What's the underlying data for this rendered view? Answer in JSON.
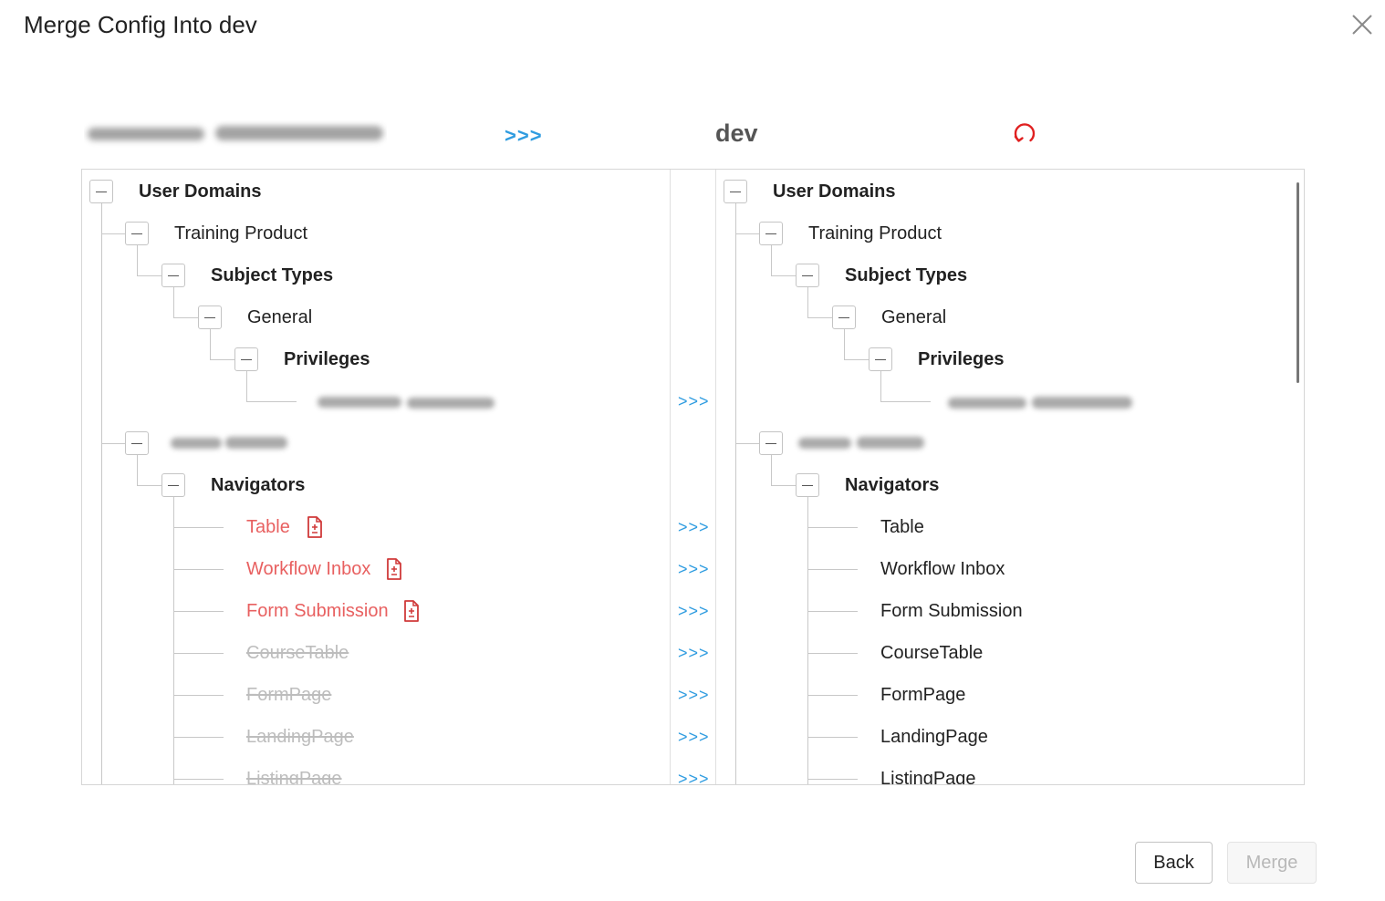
{
  "dialog": {
    "title": "Merge Config Into dev"
  },
  "header": {
    "arrow": ">>>",
    "target_name": "dev"
  },
  "left_tree": {
    "user_domains": "User Domains",
    "training_product": "Training Product",
    "subject_types": "Subject Types",
    "general": "General",
    "privileges": "Privileges",
    "navigators": "Navigators",
    "items": [
      {
        "label": "Table",
        "status": "changed"
      },
      {
        "label": "Workflow Inbox",
        "status": "changed"
      },
      {
        "label": "Form Submission",
        "status": "changed"
      },
      {
        "label": "CourseTable",
        "status": "deleted"
      },
      {
        "label": "FormPage",
        "status": "deleted"
      },
      {
        "label": "LandingPage",
        "status": "deleted"
      },
      {
        "label": "ListingPage",
        "status": "deleted"
      }
    ]
  },
  "right_tree": {
    "user_domains": "User Domains",
    "training_product": "Training Product",
    "subject_types": "Subject Types",
    "general": "General",
    "privileges": "Privileges",
    "navigators": "Navigators",
    "items": [
      {
        "label": "Table"
      },
      {
        "label": "Workflow Inbox"
      },
      {
        "label": "Form Submission"
      },
      {
        "label": "CourseTable"
      },
      {
        "label": "FormPage"
      },
      {
        "label": "LandingPage"
      },
      {
        "label": "ListingPage"
      }
    ]
  },
  "merge_arrows": [
    ">>>",
    ">>>",
    ">>>",
    ">>>",
    ">>>",
    ">>>",
    ">>>",
    ">>>"
  ],
  "buttons": {
    "back": "Back",
    "merge": "Merge"
  },
  "colors": {
    "arrow": "#2f9ce0",
    "changed": "#e86060",
    "diff_icon": "#d03a3a",
    "deleted": "#bdbdbd",
    "refresh": "#e02020"
  },
  "icons": {
    "close": "close-icon",
    "refresh": "refresh-icon",
    "diff": "document-diff-icon",
    "toggle": "collapse-minus-icon"
  }
}
